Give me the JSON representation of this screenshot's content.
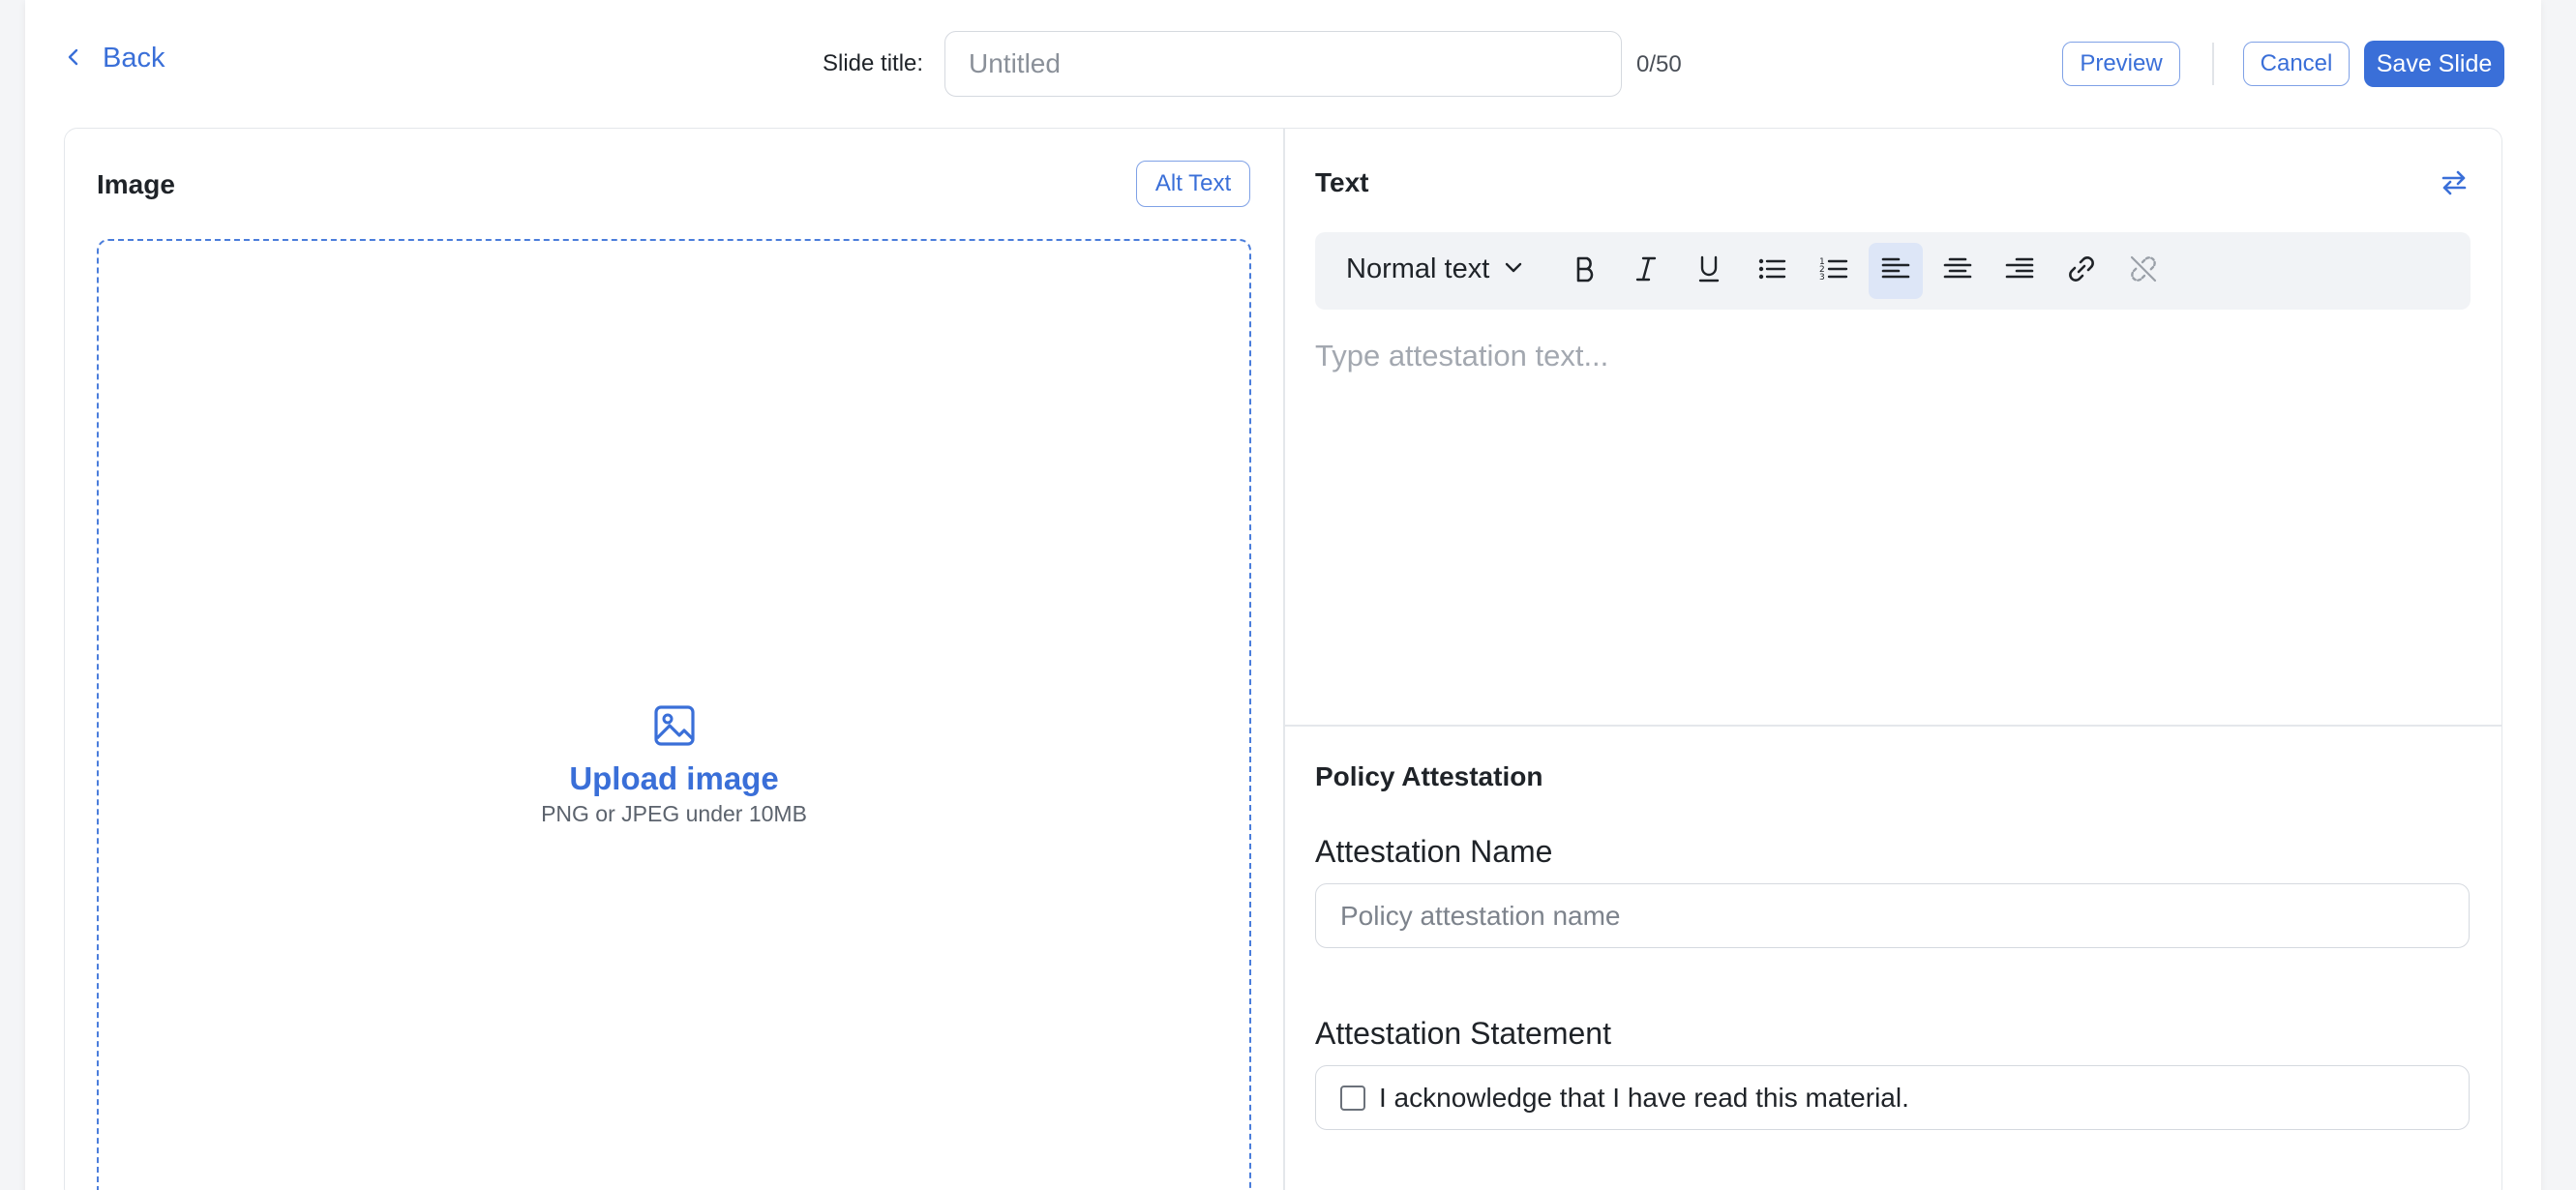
{
  "header": {
    "back_label": "Back",
    "slide_title_label": "Slide title:",
    "slide_title_placeholder": "Untitled",
    "slide_title_value": "",
    "char_count": "0/50",
    "preview_label": "Preview",
    "cancel_label": "Cancel",
    "save_label": "Save Slide"
  },
  "image_pane": {
    "title": "Image",
    "alt_text_label": "Alt Text",
    "upload_title": "Upload image",
    "upload_hint": "PNG or JPEG under 10MB",
    "icon": "image-icon"
  },
  "text_pane": {
    "title": "Text",
    "swap_icon": "swap-arrows-icon",
    "toolbar": {
      "text_style": "Normal text",
      "buttons": [
        "bold",
        "italic",
        "underline",
        "bullet-list",
        "numbered-list",
        "align-left",
        "align-center",
        "align-right",
        "link",
        "unlink"
      ],
      "active": "align-left"
    },
    "editor_placeholder": "Type attestation text..."
  },
  "attestation": {
    "section_title": "Policy Attestation",
    "name_label": "Attestation Name",
    "name_placeholder": "Policy attestation name",
    "statement_label": "Attestation Statement",
    "statement_text": "I acknowledge that I have read this material.",
    "statement_checked": false
  },
  "colors": {
    "accent": "#3a6fd8",
    "border": "#d5d9df",
    "toolbar_bg": "#f1f3f6",
    "active_bg": "#dde6f7"
  }
}
